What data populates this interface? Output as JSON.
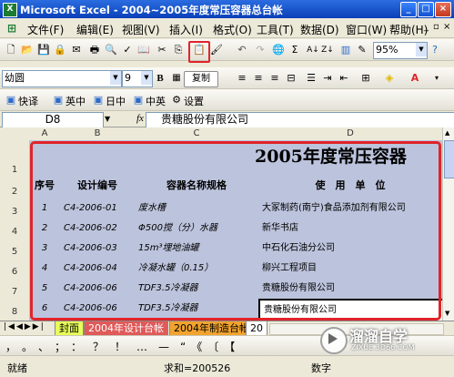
{
  "window": {
    "title": "Microsoft Excel - 2004~2005年度常压容器总台帐"
  },
  "menubar": {
    "items": [
      "文件(F)",
      "编辑(E)",
      "视图(V)",
      "插入(I)",
      "格式(O)",
      "工具(T)",
      "数据(D)",
      "窗口(W)",
      "帮助(H)"
    ]
  },
  "toolbar": {
    "zoom": "95%",
    "font": "幼圆",
    "font_size": "9",
    "bold": "B",
    "copy_format": "复制"
  },
  "quickbar": {
    "items": [
      "快译",
      "英中",
      "日中",
      "中英",
      "设置"
    ]
  },
  "formula": {
    "cell_ref": "D8",
    "fx": "fx",
    "content": "贵糖股份有限公司"
  },
  "grid": {
    "columns": [
      "A",
      "B",
      "C",
      "D"
    ],
    "rows": [
      "1",
      "2",
      "3",
      "4",
      "5",
      "6",
      "7",
      "8"
    ],
    "title": "2005年度常压容器",
    "headers": [
      "序号",
      "设计编号",
      "容器名称规格",
      "使　用　单　位"
    ],
    "data": [
      [
        "1",
        "C4-2006-01",
        "废水槽",
        "大冢制药(南宁)食品添加剂有限公司"
      ],
      [
        "2",
        "C4-2006-02",
        "Φ500搅（分）水器",
        "新华书店"
      ],
      [
        "3",
        "C4-2006-03",
        "15m³埋地油罐",
        "中石化石油分公司"
      ],
      [
        "4",
        "C4-2006-04",
        "冷凝水罐（0.15）",
        "柳兴工程项目"
      ],
      [
        "5",
        "C4-2006-06",
        "TDF3.5冷凝器",
        "贵糖股份有限公司"
      ],
      [
        "6",
        "C4-2006-06",
        "TDF3.5冷凝器",
        "贵糖股份有限公司"
      ]
    ]
  },
  "sheets": {
    "tabs": [
      "封面",
      "2004年设计台帐",
      "2004年制造台帐",
      "20"
    ]
  },
  "status": {
    "ready": "就绪",
    "sum": "求和=200526",
    "num": "数字"
  },
  "watermark": {
    "brand": "溜溜自学",
    "url": "ZIXUE.3D66.COM"
  }
}
